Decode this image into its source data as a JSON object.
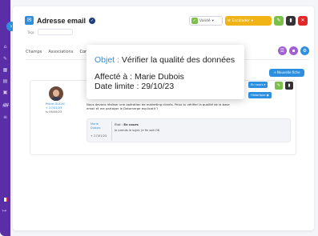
{
  "app": {
    "title": "Adresse email",
    "tags_label": "Tags"
  },
  "toolbar": {
    "valide_label": "Validé",
    "escalader_label": "Escalader"
  },
  "tabs": [
    {
      "label": "Champs"
    },
    {
      "label": "Associations"
    },
    {
      "label": "Com"
    }
  ],
  "actions": {
    "new_ticket_label": "+ Nouvelle fiche",
    "status_label": "En cours ▾",
    "historique_label": "Historique"
  },
  "ticket": {
    "author": "Pierre DUCAC",
    "created": "+ 27/01/23",
    "updated": "⇆ 06/06/23",
    "body": "Nous devons réaliser une opération de marketing clients. Peux tu vérifier la qualité de la base email et me partager le Datamerge explicatif ?"
  },
  "reply": {
    "author": "Marie Dubois",
    "date": "+ 27/01/23",
    "state_label": "État :",
    "state_value": "En cours",
    "text": "Je prends le sujet. Je fin soit OK"
  },
  "popup": {
    "objet_label": "Objet :",
    "objet_value": "Vérifier la qualité des données",
    "affecte_line": "Affecté à : Marie Dubois",
    "deadline_line": "Date limite : 29/10/23"
  },
  "colors": {
    "sidebar": "#5a2ea6",
    "accent": "#2e8fe0",
    "escalader": "#f0b416",
    "green": "#7cc04b",
    "red": "#e02828"
  }
}
